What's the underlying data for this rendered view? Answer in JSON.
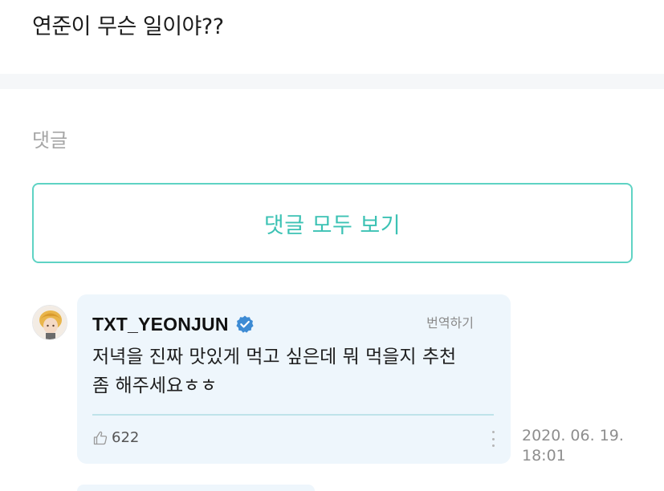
{
  "post": {
    "title": "연준이 무슨 일이야??"
  },
  "comments_section": {
    "label": "댓글",
    "view_all_label": "댓글 모두 보기",
    "accent_color": "#5fd3c4"
  },
  "comment": {
    "author": "TXT_YEONJUN",
    "verified_icon": "verified-badge-icon",
    "translate_label": "번역하기",
    "body_line1": "저녁을 진짜 맛있게 먹고 싶은데 뭐 먹을지 추천",
    "body_line2": "좀 해주세요ㅎㅎ",
    "like_icon": "thumbs-up-icon",
    "likes": "622",
    "more_icon": "more-vertical-icon",
    "date": "2020. 06. 19.",
    "time": "18:01",
    "card_color": "#eef6fc",
    "verified_color": "#3d8bd4"
  }
}
